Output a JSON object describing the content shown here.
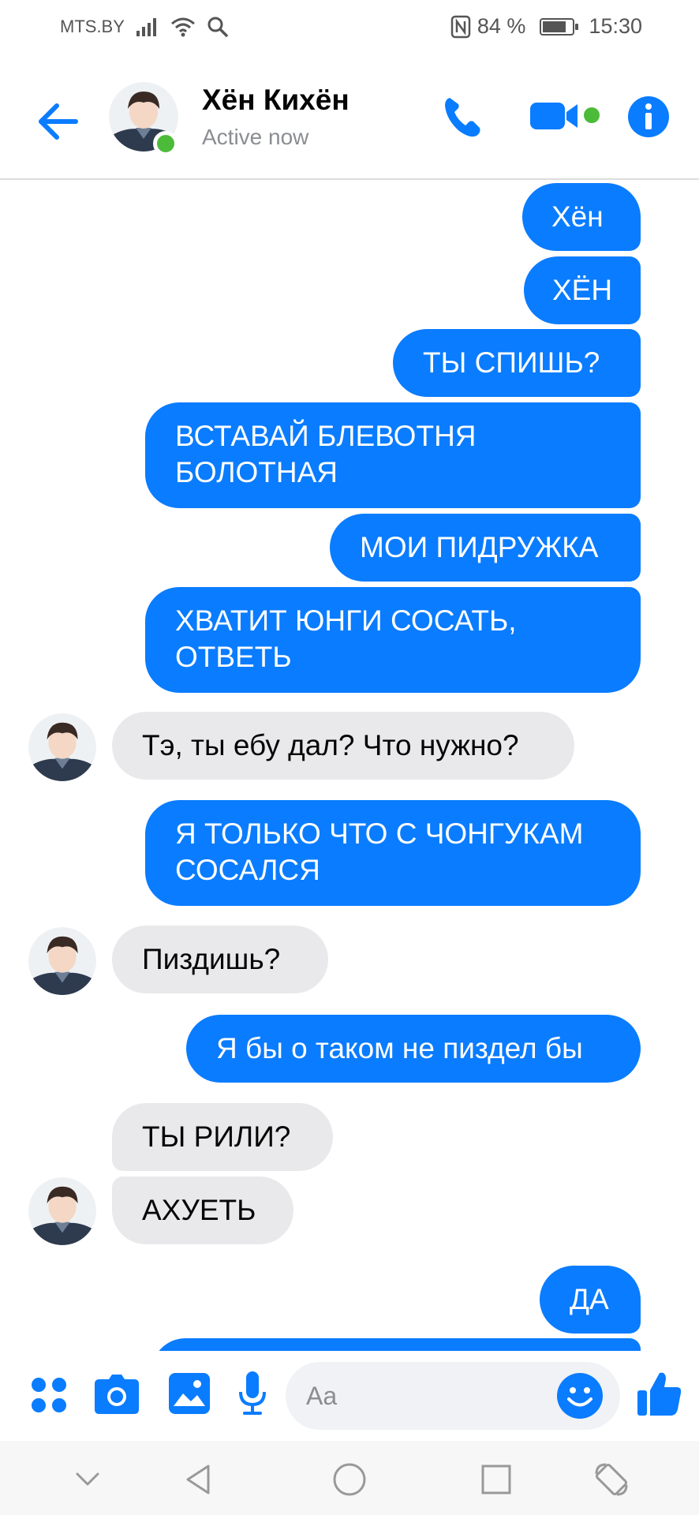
{
  "status_bar": {
    "carrier": "MTS.BY",
    "battery_percent": "84 %",
    "battery_level": 0.84,
    "time": "15:30"
  },
  "header": {
    "back_icon": "arrow-left-icon",
    "contact_name": "Хён Кихён",
    "contact_status": "Active now",
    "call_icon": "phone-icon",
    "video_icon": "video-camera-icon",
    "info_icon": "info-icon"
  },
  "colors": {
    "accent": "#0a7cff",
    "sent_bubble": "#0a7cff",
    "received_bubble": "#e9e9eb",
    "online": "#4cbb39"
  },
  "messages": [
    {
      "from": "me",
      "text": "Хён"
    },
    {
      "from": "me",
      "text": "ХЁН"
    },
    {
      "from": "me",
      "text": "ТЫ СПИШЬ?"
    },
    {
      "from": "me",
      "text": "ВСТАВАЙ БЛЕВОТНЯ\nБОЛОТНАЯ"
    },
    {
      "from": "me",
      "text": "МОИ ПИДРУЖКА"
    },
    {
      "from": "me",
      "text": "ХВАТИТ ЮНГИ СОСАТЬ,\nОТВЕТЬ"
    },
    {
      "from": "them",
      "text": "Тэ, ты ебу дал? Что нужно?"
    },
    {
      "from": "me",
      "text": "Я ТОЛЬКО ЧТО С ЧОНГУКАМ\nСОСАЛСЯ"
    },
    {
      "from": "them",
      "text": "Пиздишь?"
    },
    {
      "from": "me",
      "text": "Я бы о таком не пиздел бы"
    },
    {
      "from": "them",
      "text": "ТЫ РИЛИ?"
    },
    {
      "from": "them",
      "text": "АХУЕТЬ"
    },
    {
      "from": "me",
      "text": "ДА"
    }
  ],
  "composer": {
    "placeholder": "Aa",
    "icons": [
      "menu-dots-icon",
      "camera-icon",
      "gallery-icon",
      "microphone-icon",
      "emoji-icon",
      "thumbs-up-icon"
    ]
  },
  "navbar": {
    "icons": [
      "chevron-down-icon",
      "back-triangle-icon",
      "home-circle-icon",
      "recents-square-icon",
      "rotate-icon"
    ]
  }
}
